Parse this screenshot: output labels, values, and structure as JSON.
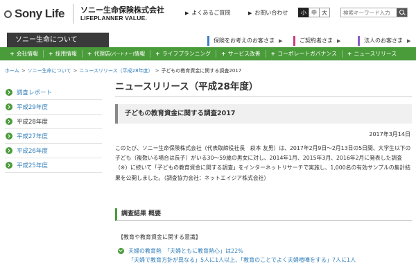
{
  "header": {
    "logo_text": "Sony Life",
    "logo_jp": "ソニー生命保険株式会社",
    "logo_en": "LIFEPLANNER VALUE.",
    "links": [
      "よくあるご質問",
      "お問い合わせ"
    ],
    "font_size_options": [
      "小",
      "中",
      "大"
    ],
    "font_size_selected": "小",
    "search_placeholder": "検索キーワード入力"
  },
  "company_tab": "ソニー生命について",
  "audience_links": [
    "保険をお考えのお客さま",
    "ご契約者さま",
    "法人のお客さま"
  ],
  "global_nav": [
    {
      "label": "会社情報"
    },
    {
      "label": "採用情報"
    },
    {
      "label": "代理店",
      "suffix": "(パートナー)",
      "label2": "情報"
    },
    {
      "label": "ライフプランニング"
    },
    {
      "label": "サービス改善"
    },
    {
      "label": "コーポレートガバナンス"
    },
    {
      "label": "ニュースリリース"
    }
  ],
  "breadcrumb": [
    "ホーム",
    "ソニー生命について",
    "ニュースリリース（平成28年度）",
    "子どもの教育資金に関する調査2017"
  ],
  "sidebar": [
    {
      "label": "調査レポート",
      "current": false
    },
    {
      "label": "平成29年度",
      "current": false
    },
    {
      "label": "平成28年度",
      "current": true
    },
    {
      "label": "平成27年度",
      "current": false
    },
    {
      "label": "平成26年度",
      "current": false
    },
    {
      "label": "平成25年度",
      "current": false
    }
  ],
  "page_title": "ニュースリリース（平成28年度）",
  "article": {
    "title": "子どもの教育資金に関する調査2017",
    "date": "2017年3月14日",
    "body": "このたび、ソニー生命保険株式会社（代表取締役社長　萩本 友男）は、2017年2月9日～2月13日の5日間、大学生以下の子ども（複数いる場合は長子）がいる30～59歳の男女に対し、2014年1月、2015年3月、2016年2月に発表した調査（※）に続いて「子どもの教育資金に関する調査」をインターネットリサーチで実施し、1,000名の有効サンプルの集計結果を公開しました。（調査協力会社：ネットエイジア株式会社）",
    "section_heading": "調査結果 概要",
    "subheading": "【教育や教育資金に関する意識】",
    "result1": "夫婦の教育熱　「夫婦ともに教育熱心」は22%",
    "result2": "「夫婦で教育方針が異なる」5人に1人以上、「教育のことでよく夫婦喧嘩をする」7人に1人"
  }
}
